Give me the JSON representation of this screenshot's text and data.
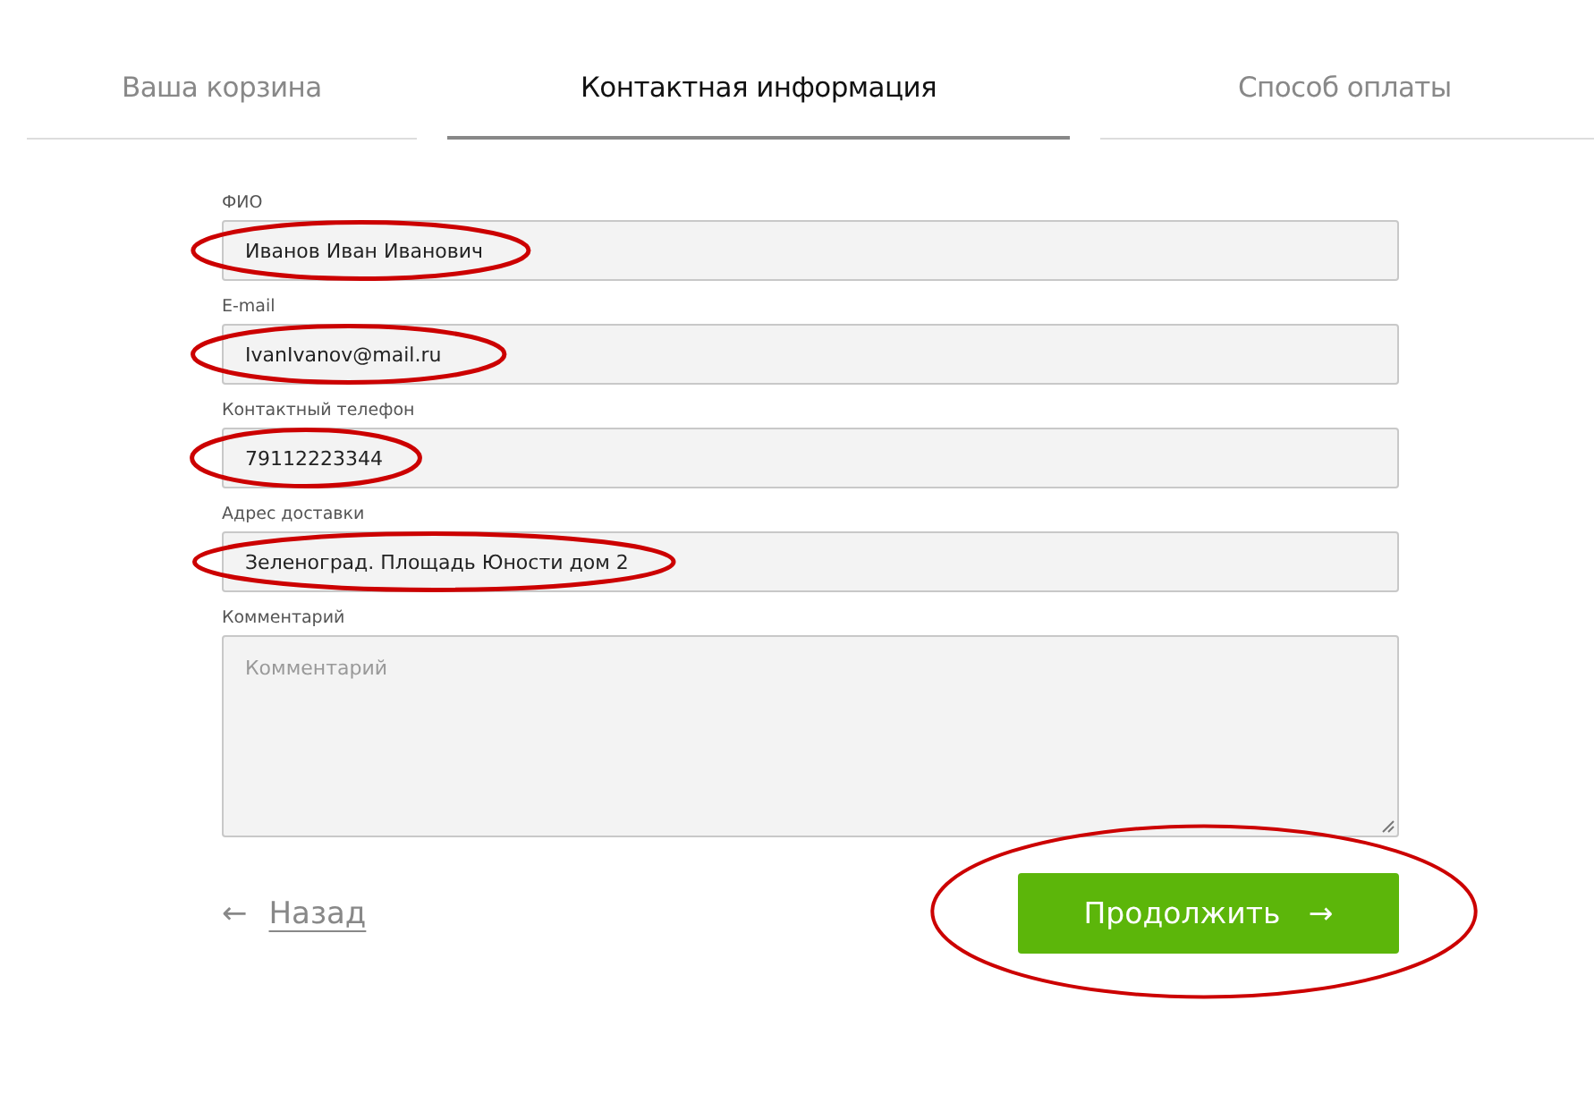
{
  "tabs": [
    {
      "label": "Ваша корзина",
      "selected": false
    },
    {
      "label": "Контактная информация",
      "selected": true
    },
    {
      "label": "Способ оплаты",
      "selected": false
    }
  ],
  "fields": [
    {
      "kind": "input",
      "label": "ФИО",
      "value": "Иванов Иван Иванович",
      "circled": true
    },
    {
      "kind": "input",
      "label": "E-mail",
      "value": "IvanIvanov@mail.ru",
      "circled": true
    },
    {
      "kind": "input",
      "label": "Контактный телефон",
      "value": "79112223344",
      "circled": true
    },
    {
      "kind": "input",
      "label": "Адрес доставки",
      "value": "Зеленоград. Площадь Юности дом 2",
      "circled": true
    },
    {
      "kind": "textarea",
      "label": "Комментарий",
      "placeholder": "Комментарий"
    }
  ],
  "back_link": {
    "arrow": "←",
    "label": "Назад"
  },
  "continue_button": {
    "label": "Продолжить",
    "arrow": "→",
    "circled": true
  }
}
